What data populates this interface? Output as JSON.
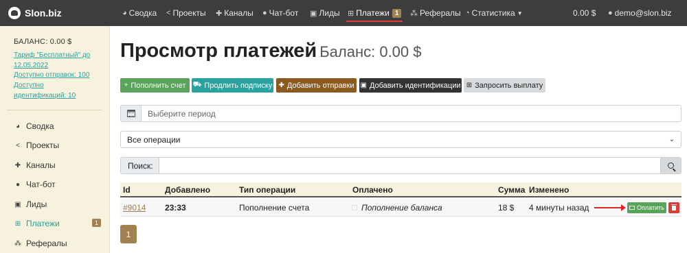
{
  "brand": {
    "name": "Slon.biz"
  },
  "nav": {
    "items": [
      {
        "label": "Сводка",
        "icon": "dashboard-icon"
      },
      {
        "label": "Проекты",
        "icon": "share-icon"
      },
      {
        "label": "Каналы",
        "icon": "puzzle-icon"
      },
      {
        "label": "Чат-бот",
        "icon": "chat-icon"
      },
      {
        "label": "Лиды",
        "icon": "contact-card-icon"
      },
      {
        "label": "Платежи",
        "icon": "payments-icon",
        "badge": "1",
        "active": true
      },
      {
        "label": "Рефералы",
        "icon": "network-icon"
      },
      {
        "label": "Статистика",
        "icon": "pie-chart-icon"
      }
    ],
    "balance": "0.00 $",
    "user": "demo@slon.biz"
  },
  "sidebar": {
    "balance_title": "БАЛАНС: 0.00 $",
    "tariff_line1": "Тариф \"Бесплатный\" до",
    "tariff_line2": "12.05.2022",
    "sends": "Доступно отправок: 100",
    "ident_line1": "Доступно",
    "ident_line2": "идентификаций: 10",
    "items": [
      {
        "label": "Сводка",
        "icon": "dashboard-icon"
      },
      {
        "label": "Проекты",
        "icon": "share-icon"
      },
      {
        "label": "Каналы",
        "icon": "puzzle-icon"
      },
      {
        "label": "Чат-бот",
        "icon": "chat-icon"
      },
      {
        "label": "Лиды",
        "icon": "contact-card-icon"
      },
      {
        "label": "Платежи",
        "icon": "payments-icon",
        "badge": "1",
        "active": true
      },
      {
        "label": "Рефералы",
        "icon": "network-icon"
      }
    ]
  },
  "page": {
    "title": "Просмотр платежей",
    "balance": "Баланс: 0.00 $"
  },
  "actions": {
    "topup": "Пополнить счет",
    "extend": "Продлить подписку",
    "add_sends": "Добавить отправки",
    "add_ident": "Добавить идентификации",
    "withdraw": "Запросить выплату"
  },
  "colors": {
    "topup": "#5aa35a",
    "extend": "#2aa3a0",
    "add_sends": "#8a5a1f",
    "add_ident": "#333333",
    "withdraw": "#d7dadd",
    "accent": "#a0814f",
    "navbar": "#3d3d3d",
    "sidebar": "#f6f2de"
  },
  "filters": {
    "period_placeholder": "Выберите период",
    "operation_selected": "Все операции",
    "search_label": "Поиск:",
    "search_value": ""
  },
  "table": {
    "headers": [
      "Id",
      "Добавлено",
      "Тип операции",
      "Оплачено",
      "Сумма",
      "Изменено"
    ],
    "rows": [
      {
        "id": "#9014",
        "added": "23:33",
        "type": "Пополнение счета",
        "paid": "Пополнение баланса",
        "amount": "18 $",
        "changed": "4 минуты назад",
        "pay_label": "Оплатить"
      }
    ]
  },
  "pagination": {
    "current": "1"
  }
}
